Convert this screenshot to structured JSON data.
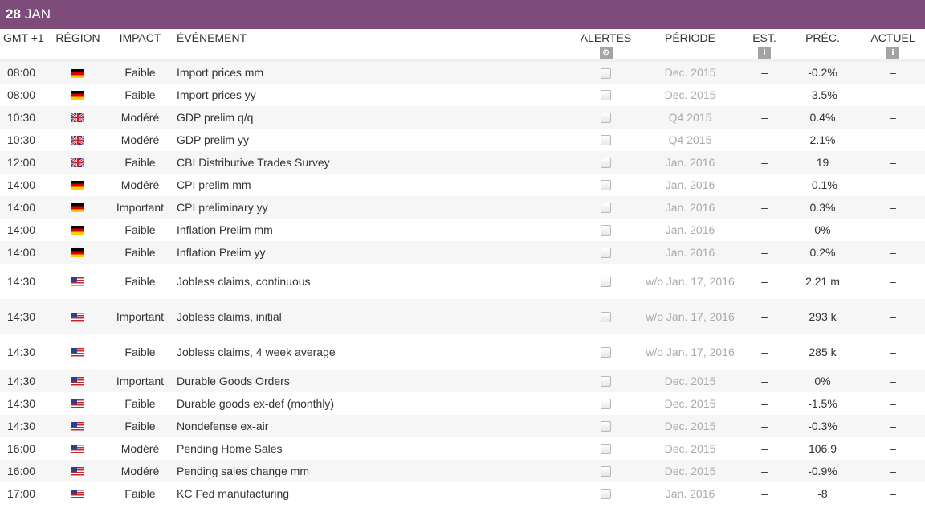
{
  "header": {
    "day": "28",
    "month": "JAN"
  },
  "columns": {
    "time": "GMT +1",
    "region": "RÉGION",
    "impact": "IMPACT",
    "event": "ÉVÉNEMENT",
    "alerts": "ALERTES",
    "period": "PÉRIODE",
    "est": "EST.",
    "prec": "PRÉC.",
    "actual": "ACTUEL"
  },
  "icons": {
    "alerts_icon": "gear-icon",
    "est_icon": "info-icon",
    "actual_icon": "info-icon"
  },
  "colors": {
    "header_bg": "#7e4c7a",
    "row_alt": "#f6f6f6",
    "period_text": "#aaaaaa"
  },
  "events": [
    {
      "time": "08:00",
      "region": "de",
      "impact": "Faible",
      "event": "Import prices mm",
      "period": "Dec. 2015",
      "est": "–",
      "prec": "-0.2%",
      "actual": "–"
    },
    {
      "time": "08:00",
      "region": "de",
      "impact": "Faible",
      "event": "Import prices yy",
      "period": "Dec. 2015",
      "est": "–",
      "prec": "-3.5%",
      "actual": "–"
    },
    {
      "time": "10:30",
      "region": "gb",
      "impact": "Modéré",
      "event": "GDP prelim q/q",
      "period": "Q4 2015",
      "est": "–",
      "prec": "0.4%",
      "actual": "–"
    },
    {
      "time": "10:30",
      "region": "gb",
      "impact": "Modéré",
      "event": "GDP prelim yy",
      "period": "Q4 2015",
      "est": "–",
      "prec": "2.1%",
      "actual": "–"
    },
    {
      "time": "12:00",
      "region": "gb",
      "impact": "Faible",
      "event": "CBI Distributive Trades Survey",
      "period": "Jan. 2016",
      "est": "–",
      "prec": "19",
      "actual": "–"
    },
    {
      "time": "14:00",
      "region": "de",
      "impact": "Modéré",
      "event": "CPI prelim mm",
      "period": "Jan. 2016",
      "est": "–",
      "prec": "-0.1%",
      "actual": "–"
    },
    {
      "time": "14:00",
      "region": "de",
      "impact": "Important",
      "event": "CPI preliminary yy",
      "period": "Jan. 2016",
      "est": "–",
      "prec": "0.3%",
      "actual": "–"
    },
    {
      "time": "14:00",
      "region": "de",
      "impact": "Faible",
      "event": "Inflation Prelim mm",
      "period": "Jan. 2016",
      "est": "–",
      "prec": "0%",
      "actual": "–"
    },
    {
      "time": "14:00",
      "region": "de",
      "impact": "Faible",
      "event": "Inflation Prelim yy",
      "period": "Jan. 2016",
      "est": "–",
      "prec": "0.2%",
      "actual": "–"
    },
    {
      "time": "14:30",
      "region": "us",
      "impact": "Faible",
      "event": "Jobless claims, continuous",
      "period": "w/o Jan. 17, 2016",
      "est": "–",
      "prec": "2.21 m",
      "actual": "–"
    },
    {
      "time": "14:30",
      "region": "us",
      "impact": "Important",
      "event": "Jobless claims, initial",
      "period": "w/o Jan. 17, 2016",
      "est": "–",
      "prec": "293 k",
      "actual": "–"
    },
    {
      "time": "14:30",
      "region": "us",
      "impact": "Faible",
      "event": "Jobless claims, 4 week average",
      "period": "w/o Jan. 17, 2016",
      "est": "–",
      "prec": "285 k",
      "actual": "–"
    },
    {
      "time": "14:30",
      "region": "us",
      "impact": "Important",
      "event": "Durable Goods Orders",
      "period": "Dec. 2015",
      "est": "–",
      "prec": "0%",
      "actual": "–"
    },
    {
      "time": "14:30",
      "region": "us",
      "impact": "Faible",
      "event": "Durable goods ex-def (monthly)",
      "period": "Dec. 2015",
      "est": "–",
      "prec": "-1.5%",
      "actual": "–"
    },
    {
      "time": "14:30",
      "region": "us",
      "impact": "Faible",
      "event": "Nondefense ex-air",
      "period": "Dec. 2015",
      "est": "–",
      "prec": "-0.3%",
      "actual": "–"
    },
    {
      "time": "16:00",
      "region": "us",
      "impact": "Modéré",
      "event": "Pending Home Sales",
      "period": "Dec. 2015",
      "est": "–",
      "prec": "106.9",
      "actual": "–"
    },
    {
      "time": "16:00",
      "region": "us",
      "impact": "Modéré",
      "event": "Pending sales change mm",
      "period": "Dec. 2015",
      "est": "–",
      "prec": "-0.9%",
      "actual": "–"
    },
    {
      "time": "17:00",
      "region": "us",
      "impact": "Faible",
      "event": "KC Fed manufacturing",
      "period": "Jan. 2016",
      "est": "–",
      "prec": "-8",
      "actual": "–"
    }
  ]
}
